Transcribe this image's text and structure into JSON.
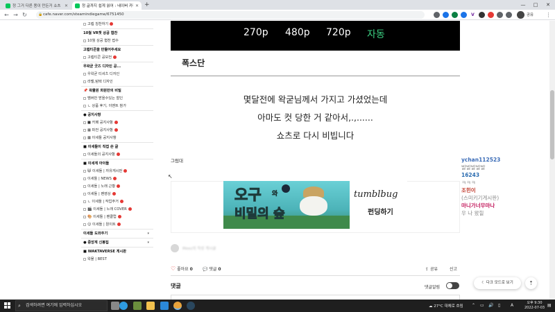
{
  "browser": {
    "tabs": [
      {
        "label": "정 그거 다른 용이 만든거 쇼츠",
        "active": false
      },
      {
        "label": "정 글까지 쉽게 읽어 : 네이버 카페",
        "active": true
      }
    ],
    "new_tab": "+",
    "url": "cafe.naver.com/steamindiegame/6751450",
    "window_controls": [
      "—",
      "□",
      "✕"
    ],
    "extensions": [
      {
        "icon": "extension-icon",
        "color": "#5f6368"
      },
      {
        "icon": "shield-icon",
        "color": "#1a73e8"
      },
      {
        "icon": "color-picker-icon",
        "color": "#0b8043"
      },
      {
        "icon": "v-icon",
        "color": "#6a1b9a",
        "glyph": "V"
      },
      {
        "icon": "dot-icon",
        "color": "#e53935"
      },
      {
        "icon": "puzzle-icon",
        "color": "#5f6368"
      }
    ],
    "profile_label": "공유"
  },
  "sidebar": {
    "items": [
      {
        "type": "item",
        "label": "고렙 칭찬하기",
        "new": true
      },
      {
        "type": "head",
        "label": "10월 VR챗 상공 협찬"
      },
      {
        "type": "item",
        "label": "10월 상공 협찬 접수"
      },
      {
        "type": "head",
        "label": "고렙티콘을 만들어주세요"
      },
      {
        "type": "item",
        "label": "고렙티콘 공모전",
        "new": true
      },
      {
        "type": "head",
        "label": "우왁굳 굿즈 디자인 공..."
      },
      {
        "type": "item",
        "label": "우왁굳 티셔츠 디자인"
      },
      {
        "type": "item",
        "label": "라벨,텀택 디자인"
      },
      {
        "type": "head",
        "label": "📌 왁물원 회원만의 비밀"
      },
      {
        "type": "item",
        "label": "멤버만 받을수있는 할인"
      },
      {
        "type": "item",
        "label": "ㄴ 상품 후기, 이벤트 참가"
      },
      {
        "type": "head",
        "label": "● 공지사항"
      },
      {
        "type": "item",
        "label": "■ 카페 공지사항",
        "new": true
      },
      {
        "type": "item",
        "label": "▦ 파전 공지사항",
        "new": true
      },
      {
        "type": "item",
        "label": "▦ 이세돌 공지사항"
      },
      {
        "type": "head",
        "label": "■ 이세돌이 직접 쓴 글"
      },
      {
        "type": "item",
        "label": "이세돌의 공지사항",
        "new": true
      },
      {
        "type": "head",
        "label": "■ 이세계 아이돌"
      },
      {
        "type": "item",
        "label": "😺 이세돌 | 자유게시판",
        "new": true
      },
      {
        "type": "item",
        "label": "이세돌 | NEWS",
        "new": true
      },
      {
        "type": "item",
        "label": "이세돌 | 노래 근황",
        "new": true
      },
      {
        "type": "item",
        "label": "이세돌 | 팬영상",
        "new": true
      },
      {
        "type": "item",
        "label": "ㄴ 이세돌 | 작업주거",
        "new": true
      },
      {
        "type": "item",
        "label": "🎬 이세돌 | 노래 COVER",
        "new": true
      },
      {
        "type": "item",
        "label": "🎨 이세돌 | 팬클럽",
        "new": true
      },
      {
        "type": "item",
        "label": "😊 이세돌 | 원이트",
        "new": true
      },
      {
        "type": "head",
        "label": "이세돌 도와주기",
        "arrow": "▾"
      },
      {
        "type": "head",
        "label": "● 중앙계 신봉집",
        "arrow": "▾"
      },
      {
        "type": "head",
        "label": "■ WAKTAVERSE 게시판"
      },
      {
        "type": "item",
        "label": "왁물 | BEST"
      }
    ]
  },
  "video": {
    "qualities": [
      "270p",
      "480p",
      "720p",
      "자동"
    ]
  },
  "post": {
    "title": "폭스단",
    "lines": [
      "몇달전에 왁굳님께서 가지고 가셨었는데",
      "아마도 컷 당한 거 같아서,.,......",
      "쇼츠로 다시 비빕니다"
    ],
    "small_text": "그럼대",
    "banner": {
      "title_part1": "오구",
      "title_wa": "와",
      "title_part2": "비밀의 숲",
      "brand": "tumblbug",
      "cta": "펀딩하기"
    },
    "author_name": "Meez의 작성 게시글",
    "like_label": "좋아요",
    "like_count": "0",
    "comment_label": "댓글",
    "comment_count": "0",
    "share_label": "공유",
    "report_label": "신고",
    "comment_heading": "댓글",
    "comment_sort_label": "댓글알림"
  },
  "chat": [
    {
      "text": "ychan112523",
      "color": "#3b6cb7"
    },
    {
      "text": "발발발발발",
      "color": "#888888"
    },
    {
      "text": "16243",
      "color": "#2b6cb0"
    },
    {
      "text": "ㅋㅋㅋ",
      "color": "#888888"
    },
    {
      "text": "조힌이",
      "color": "#c0392b"
    },
    {
      "text": "(스미키기게시판)",
      "color": "#888888"
    },
    {
      "text": "마니가너무마나",
      "color": "#c2185b"
    },
    {
      "text": "우 나 왔힐",
      "color": "#888888"
    }
  ],
  "floating": {
    "dark_mode_label": "☾ 다크 모드로 보기",
    "top_label": "⇡"
  },
  "taskbar": {
    "search_placeholder": "검색하려면 여기에 입력하십시오",
    "weather": "27°C 대체로 흐림",
    "time": "오후 9:30",
    "date": "2022-07-03",
    "lang": "A",
    "apps": [
      {
        "icon": "task-view-icon",
        "color": "#cccccc"
      },
      {
        "icon": "edge-icon",
        "color": "#2f9be0"
      },
      {
        "icon": "minecraft-icon",
        "color": "#6b8e3d"
      },
      {
        "icon": "file-explorer-icon",
        "color": "#f2c14e"
      },
      {
        "icon": "visual-studio-icon",
        "color": "#2b88d8"
      },
      {
        "icon": "chrome-icon",
        "color": "#e8a33b"
      },
      {
        "icon": "steam-icon",
        "color": "#2a475e"
      }
    ]
  }
}
